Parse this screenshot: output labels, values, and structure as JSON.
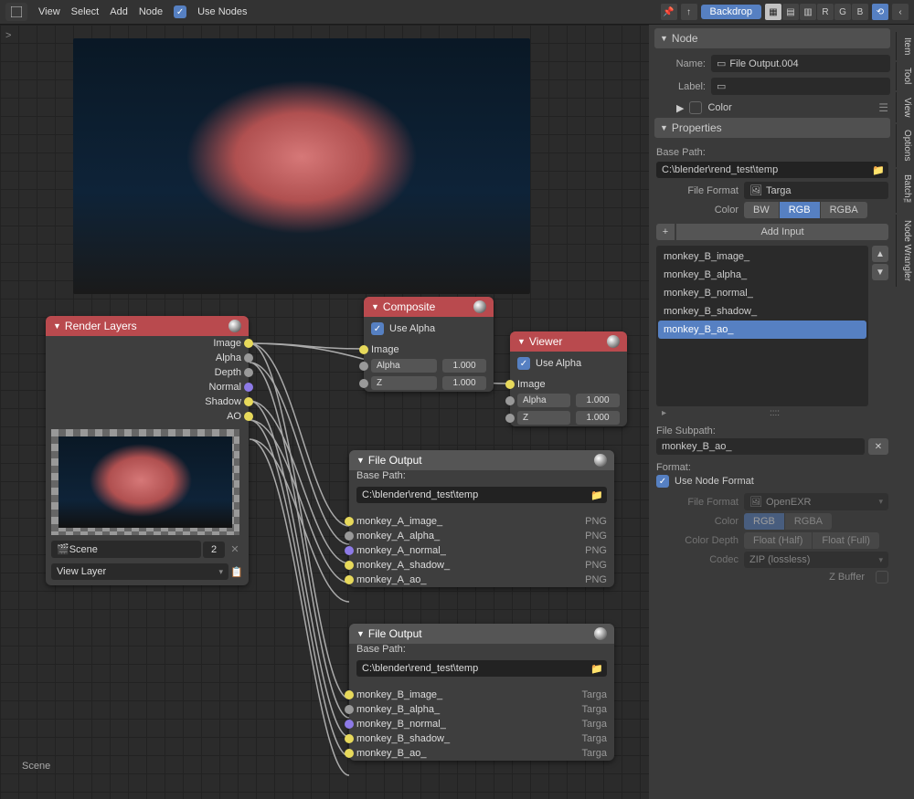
{
  "menu": {
    "view": "View",
    "select": "Select",
    "add": "Add",
    "node": "Node",
    "useNodes": "Use Nodes"
  },
  "toolbar": {
    "backdrop": "Backdrop",
    "r": "R",
    "g": "G",
    "b": "B"
  },
  "breadcrumb": ">",
  "sceneLabel": "Scene",
  "nodes": {
    "renderLayers": {
      "title": "Render Layers",
      "outputs": [
        "Image",
        "Alpha",
        "Depth",
        "Normal",
        "Shadow",
        "AO"
      ],
      "scene": "Scene",
      "sceneCount": "2",
      "viewLayer": "View Layer"
    },
    "composite": {
      "title": "Composite",
      "useAlpha": "Use Alpha",
      "image": "Image",
      "alpha": "Alpha",
      "alphaVal": "1.000",
      "z": "Z",
      "zVal": "1.000"
    },
    "viewer": {
      "title": "Viewer",
      "useAlpha": "Use Alpha",
      "image": "Image",
      "alpha": "Alpha",
      "alphaVal": "1.000",
      "z": "Z",
      "zVal": "1.000"
    },
    "fileOutA": {
      "title": "File Output",
      "basePath": "Base Path:",
      "path": "C:\\blender\\rend_test\\temp",
      "rows": [
        {
          "name": "monkey_A_image_",
          "fmt": "PNG",
          "c": "socket-yellow"
        },
        {
          "name": "monkey_A_alpha_",
          "fmt": "PNG",
          "c": "socket-grey"
        },
        {
          "name": "monkey_A_normal_",
          "fmt": "PNG",
          "c": "socket-purple"
        },
        {
          "name": "monkey_A_shadow_",
          "fmt": "PNG",
          "c": "socket-yellow"
        },
        {
          "name": "monkey_A_ao_",
          "fmt": "PNG",
          "c": "socket-yellow"
        }
      ]
    },
    "fileOutB": {
      "title": "File Output",
      "basePath": "Base Path:",
      "path": "C:\\blender\\rend_test\\temp",
      "rows": [
        {
          "name": "monkey_B_image_",
          "fmt": "Targa",
          "c": "socket-yellow"
        },
        {
          "name": "monkey_B_alpha_",
          "fmt": "Targa",
          "c": "socket-grey"
        },
        {
          "name": "monkey_B_normal_",
          "fmt": "Targa",
          "c": "socket-purple"
        },
        {
          "name": "monkey_B_shadow_",
          "fmt": "Targa",
          "c": "socket-yellow"
        },
        {
          "name": "monkey_B_ao_",
          "fmt": "Targa",
          "c": "socket-yellow"
        }
      ]
    }
  },
  "side": {
    "tabs": [
      "Item",
      "Tool",
      "View",
      "Options",
      "Batch™",
      "Node Wrangler"
    ],
    "node": "Node",
    "name": "Name:",
    "nameVal": "File Output.004",
    "label": "Label:",
    "labelVal": "",
    "colorLabel": "Color",
    "properties": "Properties",
    "basePath": "Base Path:",
    "basePathVal": "C:\\blender\\rend_test\\temp",
    "fileFormat": "File Format",
    "fileFormatVal": "Targa",
    "colorRow": "Color",
    "bw": "BW",
    "rgb": "RGB",
    "rgba": "RGBA",
    "addInput": "Add Input",
    "inputs": [
      "monkey_B_image_",
      "monkey_B_alpha_",
      "monkey_B_normal_",
      "monkey_B_shadow_",
      "monkey_B_ao_"
    ],
    "selectedInput": 4,
    "fileSubpath": "File Subpath:",
    "fileSubpathVal": "monkey_B_ao_",
    "format": "Format:",
    "useNodeFormat": "Use Node Format",
    "dimFormat": "OpenEXR",
    "dimRgb": "RGB",
    "dimRgba": "RGBA",
    "colorDepth": "Color Depth",
    "half": "Float (Half)",
    "full": "Float (Full)",
    "codec": "Codec",
    "codecVal": "ZIP (lossless)",
    "zbuffer": "Z Buffer"
  }
}
